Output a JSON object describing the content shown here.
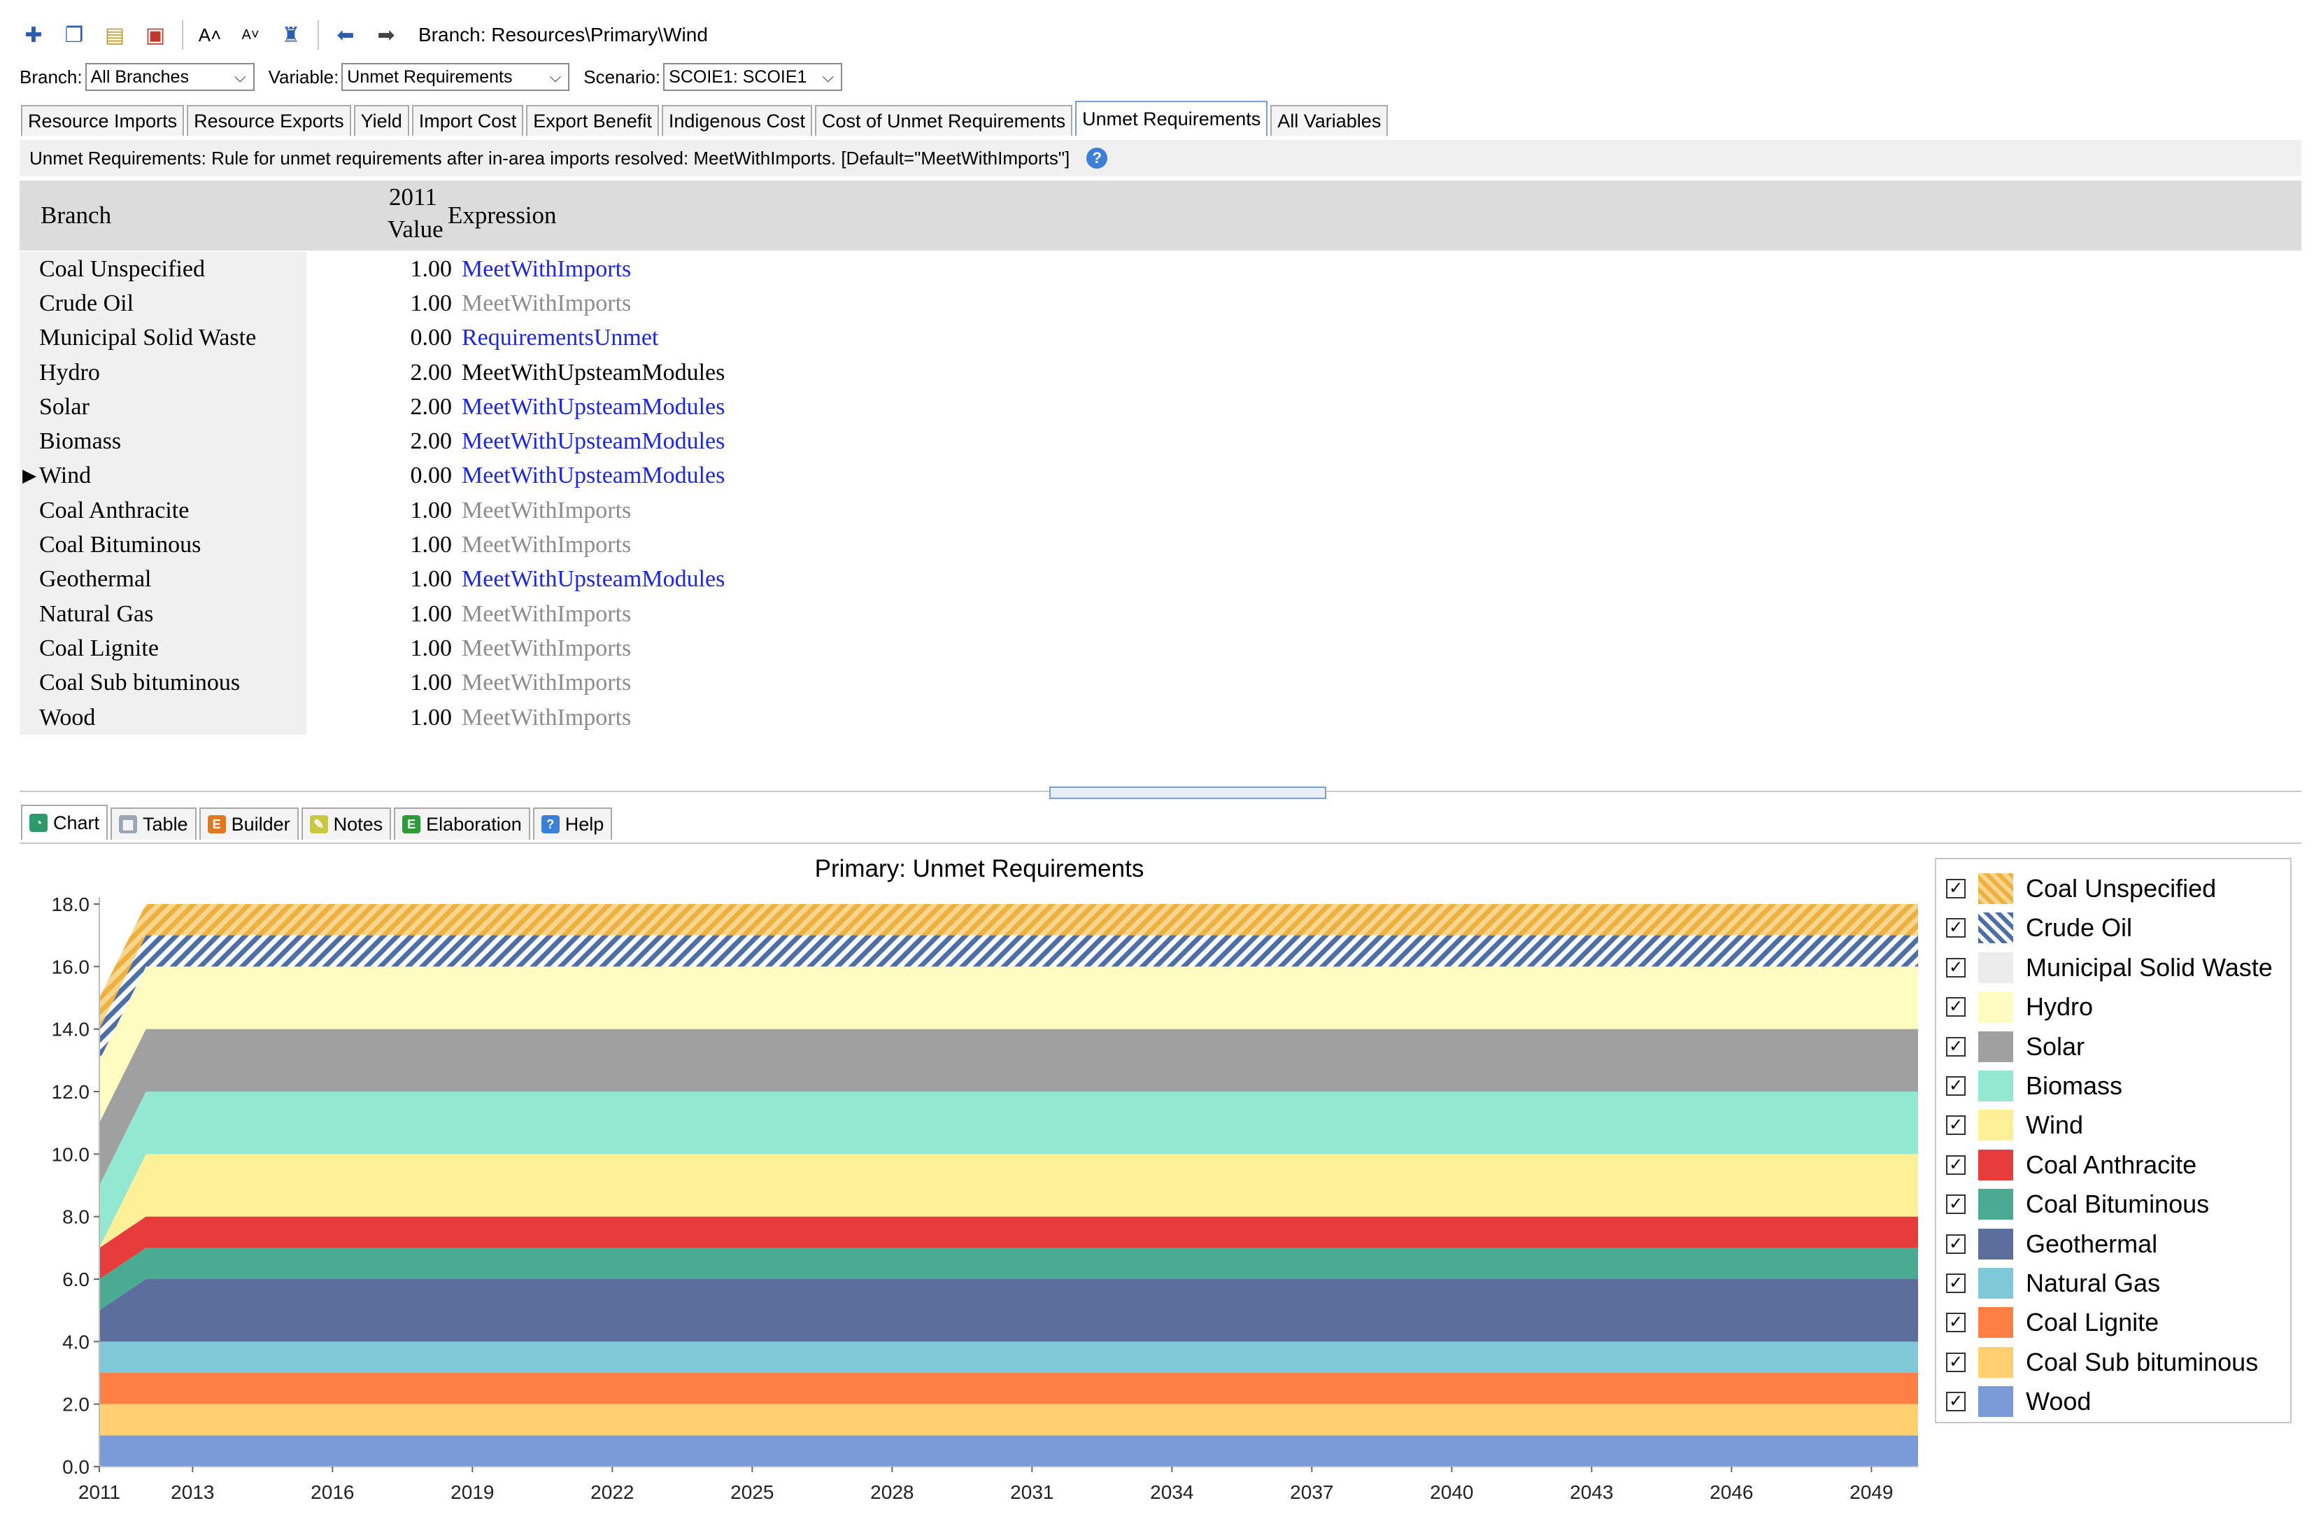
{
  "toolbar": {
    "icons": [
      "pin-icon",
      "copy-icon",
      "paste-icon",
      "save-icon",
      "font-larger-icon",
      "font-smaller-icon",
      "tree-icon",
      "back-arrow-icon",
      "forward-arrow-icon"
    ],
    "branch_path": "Branch: Resources\\Primary\\Wind"
  },
  "selectors": {
    "branch_label": "Branch:",
    "branch_value": "All Branches",
    "variable_label": "Variable:",
    "variable_value": "Unmet Requirements",
    "scenario_label": "Scenario:",
    "scenario_value": "SCOIE1: SCOIE1"
  },
  "variable_tabs": [
    {
      "label": "Resource Imports",
      "active": false
    },
    {
      "label": "Resource Exports",
      "active": false
    },
    {
      "label": "Yield",
      "active": false
    },
    {
      "label": "Import Cost",
      "active": false
    },
    {
      "label": "Export Benefit",
      "active": false
    },
    {
      "label": "Indigenous Cost",
      "active": false
    },
    {
      "label": "Cost of Unmet Requirements",
      "active": false
    },
    {
      "label": "Unmet Requirements",
      "active": true
    },
    {
      "label": "All Variables",
      "active": false
    }
  ],
  "description": "Unmet Requirements: Rule for unmet requirements after in-area imports resolved: MeetWithImports. [Default=\"MeetWithImports\"]",
  "grid": {
    "col_branch": "Branch",
    "col_year": "2011",
    "col_value": "Value",
    "col_expression": "Expression",
    "rows": [
      {
        "branch": "Coal Unspecified",
        "value": "1.00",
        "expression": "MeetWithImports",
        "style": "blue"
      },
      {
        "branch": "Crude Oil",
        "value": "1.00",
        "expression": "MeetWithImports",
        "style": "gray"
      },
      {
        "branch": "Municipal Solid Waste",
        "value": "0.00",
        "expression": "RequirementsUnmet",
        "style": "blue"
      },
      {
        "branch": "Hydro",
        "value": "2.00",
        "expression": "MeetWithUpsteamModules",
        "style": "black"
      },
      {
        "branch": "Solar",
        "value": "2.00",
        "expression": "MeetWithUpsteamModules",
        "style": "blue"
      },
      {
        "branch": "Biomass",
        "value": "2.00",
        "expression": "MeetWithUpsteamModules",
        "style": "blue"
      },
      {
        "branch": "Wind",
        "value": "0.00",
        "expression": "MeetWithUpsteamModules",
        "style": "blue",
        "current": true
      },
      {
        "branch": "Coal Anthracite",
        "value": "1.00",
        "expression": "MeetWithImports",
        "style": "gray"
      },
      {
        "branch": "Coal Bituminous",
        "value": "1.00",
        "expression": "MeetWithImports",
        "style": "gray"
      },
      {
        "branch": "Geothermal",
        "value": "1.00",
        "expression": "MeetWithUpsteamModules",
        "style": "blue"
      },
      {
        "branch": "Natural Gas",
        "value": "1.00",
        "expression": "MeetWithImports",
        "style": "gray"
      },
      {
        "branch": "Coal Lignite",
        "value": "1.00",
        "expression": "MeetWithImports",
        "style": "gray"
      },
      {
        "branch": "Coal Sub bituminous",
        "value": "1.00",
        "expression": "MeetWithImports",
        "style": "gray"
      },
      {
        "branch": "Wood",
        "value": "1.00",
        "expression": "MeetWithImports",
        "style": "gray"
      }
    ],
    "current_marker": "▶"
  },
  "view_tabs": [
    {
      "label": "Chart",
      "icon": "chart-icon",
      "active": true,
      "color": "#2e9a6a"
    },
    {
      "label": "Table",
      "icon": "table-icon",
      "active": false,
      "color": "#9aa5b5"
    },
    {
      "label": "Builder",
      "icon": "builder-icon",
      "active": false,
      "color": "#e07820"
    },
    {
      "label": "Notes",
      "icon": "notes-icon",
      "active": false,
      "color": "#c9c640"
    },
    {
      "label": "Elaboration",
      "icon": "elaboration-icon",
      "active": false,
      "color": "#2e9a3a"
    },
    {
      "label": "Help",
      "icon": "help-icon",
      "active": false,
      "color": "#3b7fd9"
    }
  ],
  "chart_data": {
    "type": "area",
    "stacked": true,
    "title": "Primary: Unmet Requirements",
    "xlabel": "",
    "ylabel": "",
    "x": [
      2011,
      2012,
      2050
    ],
    "x_ticks": [
      2011,
      2013,
      2016,
      2019,
      2022,
      2025,
      2028,
      2031,
      2034,
      2037,
      2040,
      2043,
      2046,
      2049
    ],
    "ylim": [
      0,
      18
    ],
    "y_ticks": [
      "0.0",
      "2.0",
      "4.0",
      "6.0",
      "8.0",
      "10.0",
      "12.0",
      "14.0",
      "16.0",
      "18.0"
    ],
    "grid": false,
    "legend_position": "right",
    "series": [
      {
        "name": "Wood",
        "values": [
          1,
          1,
          1
        ],
        "color": "#7b9bd8"
      },
      {
        "name": "Coal Sub bituminous",
        "values": [
          1,
          1,
          1
        ],
        "color": "#ffcf70"
      },
      {
        "name": "Coal Lignite",
        "values": [
          1,
          1,
          1
        ],
        "color": "#ff7f45"
      },
      {
        "name": "Natural Gas",
        "values": [
          1,
          1,
          1
        ],
        "color": "#7ec8d8"
      },
      {
        "name": "Geothermal",
        "values": [
          1,
          2,
          2
        ],
        "color": "#5c6f9c"
      },
      {
        "name": "Coal Bituminous",
        "values": [
          1,
          1,
          1
        ],
        "color": "#4aaa92"
      },
      {
        "name": "Coal Anthracite",
        "values": [
          1,
          1,
          1
        ],
        "color": "#e63c3c"
      },
      {
        "name": "Wind",
        "values": [
          0,
          2,
          2
        ],
        "color": "#fef096"
      },
      {
        "name": "Biomass",
        "values": [
          2,
          2,
          2
        ],
        "color": "#93e8d2"
      },
      {
        "name": "Solar",
        "values": [
          2,
          2,
          2
        ],
        "color": "#a0a0a0"
      },
      {
        "name": "Hydro",
        "values": [
          2,
          2,
          2
        ],
        "color": "#fefcc0"
      },
      {
        "name": "Municipal Solid Waste",
        "values": [
          0,
          0,
          0
        ],
        "color": "#ececec"
      },
      {
        "name": "Crude Oil",
        "values": [
          1,
          1,
          1
        ],
        "color": "#4c6fa8",
        "pattern": "hatch"
      },
      {
        "name": "Coal Unspecified",
        "values": [
          1,
          1,
          1
        ],
        "color": "#f0b040",
        "pattern": "hatch"
      }
    ]
  }
}
